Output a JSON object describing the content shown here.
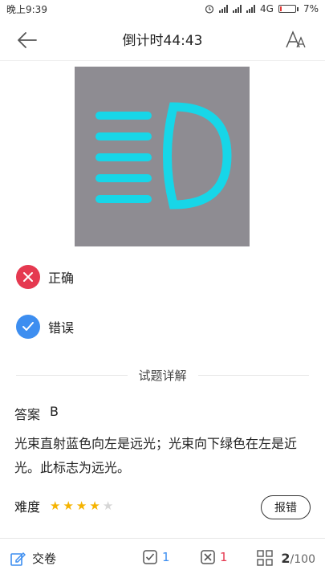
{
  "status": {
    "time": "晚上9:39",
    "network": "4G",
    "battery": "7%"
  },
  "header": {
    "title": "倒计时44:43"
  },
  "question": {
    "image_icon": "high-beam-indicator-icon"
  },
  "options": [
    {
      "label": "正确",
      "icon": "close-icon",
      "color": "#e53950"
    },
    {
      "label": "错误",
      "icon": "check-icon",
      "color": "#3d8ef0"
    }
  ],
  "detail": {
    "heading": "试题详解",
    "answer_label": "答案",
    "answer_value": "B",
    "explanation": "光束直射蓝色向左是远光；光束向下绿色在左是近光。此标志为远光。",
    "difficulty_label": "难度",
    "difficulty_rating": 4,
    "difficulty_max": 5,
    "report_label": "报错"
  },
  "bottom": {
    "submit_label": "交卷",
    "correct_count": "1",
    "wrong_count": "1",
    "current": "2",
    "total": "/100"
  },
  "colors": {
    "accent_blue": "#3d8ef0",
    "error_red": "#e53950",
    "star": "#f5b301",
    "star_empty": "#d6d6d6",
    "beam": "#17d6e8"
  }
}
